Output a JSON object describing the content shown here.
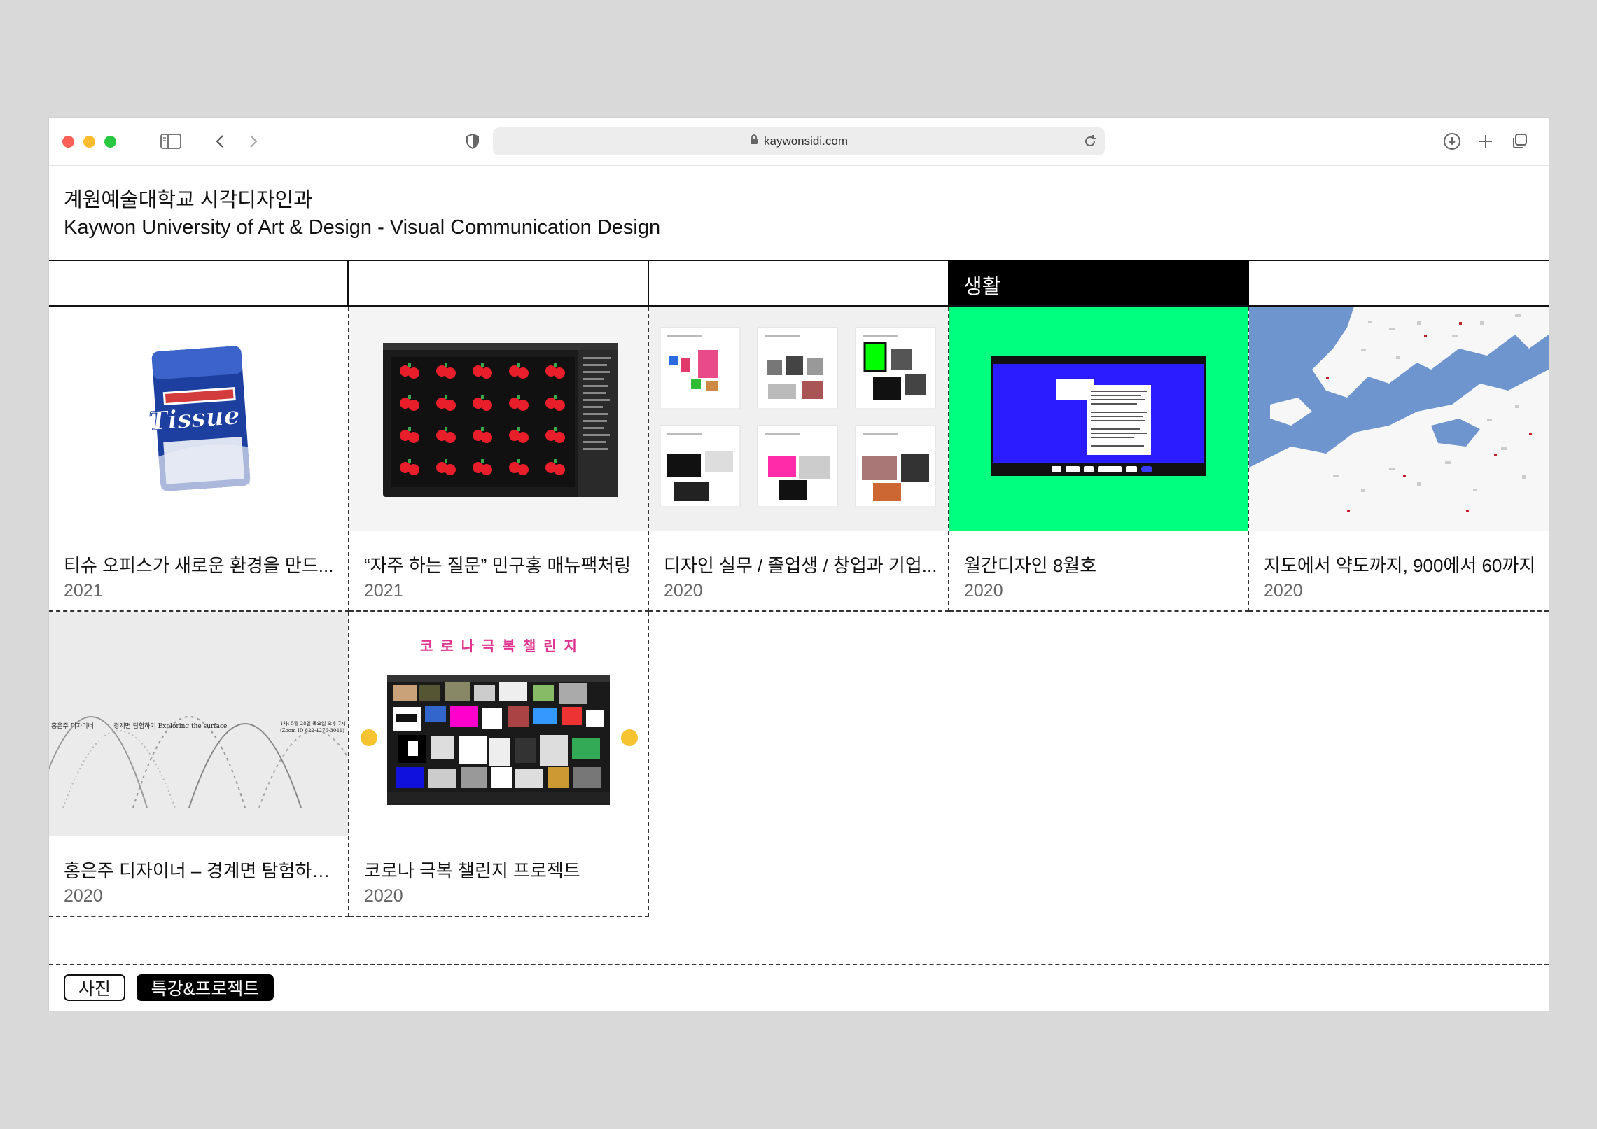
{
  "browser": {
    "url": "kaywonsidi.com"
  },
  "site": {
    "title_ko": "계원예술대학교 시각디자인과",
    "title_en": "Kaywon University of Art & Design - Visual Communication Design"
  },
  "categories": [
    {
      "label": ""
    },
    {
      "label": ""
    },
    {
      "label": ""
    },
    {
      "label": "생활",
      "active": true
    },
    {
      "label": ""
    }
  ],
  "posts": [
    {
      "title": "티슈 오피스가 새로운 환경을 만드...",
      "year": "2021",
      "thumb_text": "Tissue"
    },
    {
      "title": "“자주 하는 질문” 민구홍 매뉴팩처링",
      "year": "2021"
    },
    {
      "title": "디자인 실무 / 졸업생 / 창업과 기업...",
      "year": "2020"
    },
    {
      "title": "월간디자인 8월호",
      "year": "2020"
    },
    {
      "title": "지도에서 약도까지, 900에서 60까지",
      "year": "2020"
    },
    {
      "title": "홍은주 디자이너 – 경계면 탐험하기 ...",
      "year": "2020",
      "thumb_text": [
        "홍은주 디자이너",
        "경계면 탐험하기 Exploring the surface",
        "1차: 5월 28일 목요일 오후 7시",
        "(Zoom ID 822-1276-3041)"
      ]
    },
    {
      "title": "코로나 극복 챌린지 프로젝트",
      "year": "2020",
      "thumb_text": "코 로 나 극 복 챌 린 지"
    }
  ],
  "filters": [
    {
      "label": "사진",
      "selected": false
    },
    {
      "label": "특강&프로젝트",
      "selected": true
    }
  ],
  "colors": {
    "accent_green": "#00ff7f",
    "accent_blue": "#2a1cff",
    "map_water": "#6f95cf"
  }
}
